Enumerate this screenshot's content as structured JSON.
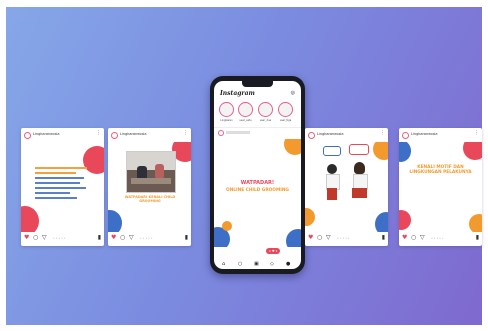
{
  "posts": [
    {
      "username": "Lingkaraneosia",
      "text": "",
      "nav_dots": "• • • • •"
    },
    {
      "username": "Lingkaraneosia",
      "text": "WATPADAR! KENALI CHILD GROOMING",
      "nav_dots": "• • • • •"
    },
    {
      "username": "Lingkaraneosia",
      "text": "",
      "nav_dots": "• • • • •"
    },
    {
      "username": "Lingkaraneosia",
      "text": "KENALI MOTIF DAN LINGKUNGAN PELAKUNYA",
      "nav_dots": "• • • • •"
    }
  ],
  "phone": {
    "app_title": "Instagram",
    "stories": [
      {
        "label": "Lingkaran"
      },
      {
        "label": "user_satu"
      },
      {
        "label": "user_dua"
      },
      {
        "label": "user_tiga"
      }
    ],
    "post_title_line1": "WATPADAR!",
    "post_title_line2": "ONLINE CHILD GROOMING",
    "swipe_label": "geser >>",
    "notif_badge": "1 ♥ 1"
  },
  "icons": {
    "heart": "heart-icon",
    "comment": "comment-icon",
    "share": "share-icon",
    "bookmark": "bookmark-icon"
  },
  "colors": {
    "accent_red": "#e9475a",
    "accent_orange": "#f39a2e",
    "accent_blue": "#3d6fc7"
  }
}
